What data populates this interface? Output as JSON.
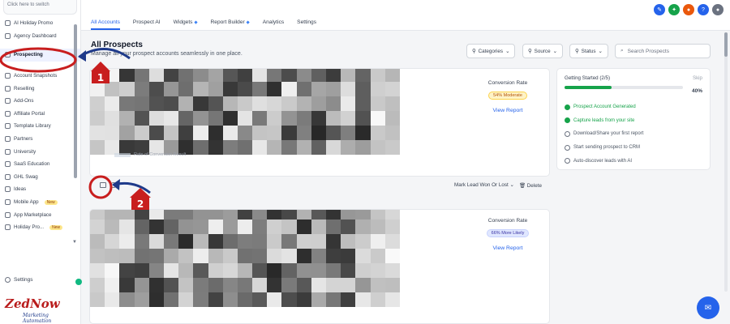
{
  "sidebar": {
    "top_label": "Click here to switch",
    "items": [
      {
        "label": "AI Holiday Promo"
      },
      {
        "label": "Agency Dashboard"
      },
      {
        "label": "Prospecting"
      },
      {
        "label": "Account Snapshots"
      },
      {
        "label": "Reselling"
      },
      {
        "label": "Add-Ons"
      },
      {
        "label": "Affiliate Portal"
      },
      {
        "label": "Template Library"
      },
      {
        "label": "Partners"
      },
      {
        "label": "University"
      },
      {
        "label": "SaaS Education"
      },
      {
        "label": "GHL Swag"
      },
      {
        "label": "Ideas"
      },
      {
        "label": "Mobile App",
        "badge": "New"
      },
      {
        "label": "App Marketplace"
      },
      {
        "label": "Holiday Pro...",
        "badge": "New"
      }
    ],
    "settings_label": "Settings"
  },
  "tabs": [
    {
      "label": "All Accounts"
    },
    {
      "label": "Prospect AI"
    },
    {
      "label": "Widgets"
    },
    {
      "label": "Report Builder"
    },
    {
      "label": "Analytics"
    },
    {
      "label": "Settings"
    }
  ],
  "main": {
    "title": "All Prospects",
    "subtitle": "Manage all your prospect accounts seamlessly in one place.",
    "filters": {
      "categories": "Categories",
      "source": "Source",
      "status": "Status"
    },
    "search_placeholder": "Search Prospects"
  },
  "prospects": [
    {
      "conversion_label": "Conversion Rate",
      "rate": "54%",
      "level": "Moderate",
      "view_link": "View Report",
      "faded_text": "Rate of Conversion Result"
    },
    {
      "conversion_label": "Conversion Rate",
      "rate": "66%",
      "level": "More Likely",
      "view_link": "View Report"
    }
  ],
  "card_actions": {
    "mark_label": "Mark Lead Won Or Lost",
    "delete_label": "Delete"
  },
  "getting_started": {
    "title": "Getting Started (2/5)",
    "skip": "Skip",
    "percent": "40%",
    "progress": 0.4,
    "steps": [
      {
        "label": "Prospect Account Generated",
        "done": true
      },
      {
        "label": "Capture leads from your site",
        "done": true
      },
      {
        "label": "Download/Share your first report",
        "done": false
      },
      {
        "label": "Start sending prospect to CRM",
        "done": false
      },
      {
        "label": "Auto-discover leads with AI",
        "done": false
      }
    ]
  },
  "annotations": {
    "label1": "1",
    "label2": "2"
  },
  "logo": {
    "brand": "ZedNow",
    "tagline": "Marketing Automation"
  },
  "colors": {
    "accent": "#2563eb",
    "progress": "#16a34a",
    "annotation": "#c81e1e",
    "arrow": "#1e3a8a"
  }
}
